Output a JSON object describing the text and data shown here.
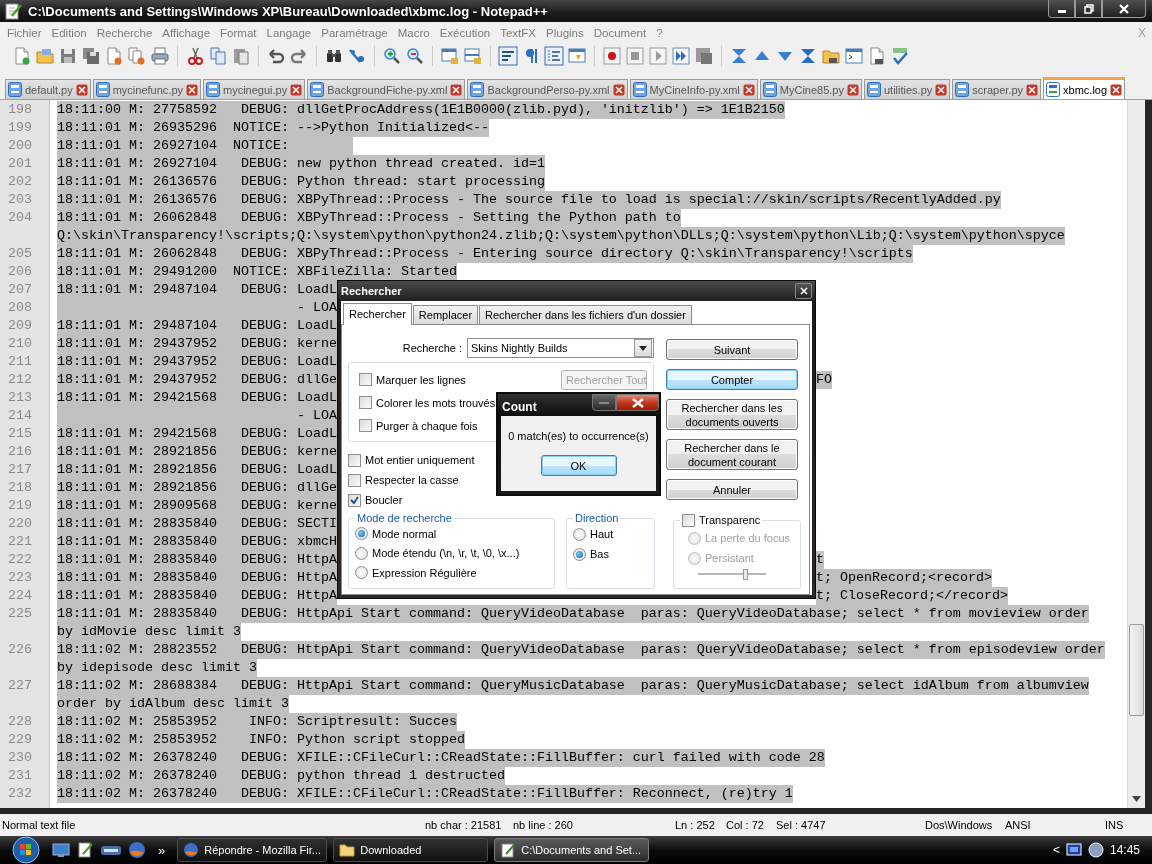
{
  "window": {
    "title": "C:\\Documents and Settings\\Windows XP\\Bureau\\Downloaded\\xbmc.log - Notepad++"
  },
  "menu": [
    "Fichier",
    "Edition",
    "Recherche",
    "Affichage",
    "Format",
    "Langage",
    "Paramétrage",
    "Macro",
    "Exécution",
    "TextFX",
    "Plugins",
    "Document",
    "?"
  ],
  "menu_close": "X",
  "tabs": [
    {
      "label": "default.py",
      "selected": false
    },
    {
      "label": "mycinefunc.py",
      "selected": false
    },
    {
      "label": "mycinegui.py",
      "selected": false
    },
    {
      "label": "BackgroundFiche-py.xml",
      "selected": false
    },
    {
      "label": "BackgroundPerso-py.xml",
      "selected": false
    },
    {
      "label": "MyCineInfo-py.xml",
      "selected": false
    },
    {
      "label": "MyCine85.py",
      "selected": false
    },
    {
      "label": "utilities.py",
      "selected": false
    },
    {
      "label": "scraper.py",
      "selected": false
    },
    {
      "label": "xbmc.log",
      "selected": true
    }
  ],
  "editor": {
    "lines": [
      {
        "number": "198",
        "text": "18:11:00 M: 27758592   DEBUG: dllGetProcAddress(1E1B0000(zlib.pyd), 'initzlib') => 1E1B2150",
        "selected": true
      },
      {
        "number": "199",
        "text": "18:11:01 M: 26935296  NOTICE: -->Python Initialized<--",
        "selected": true
      },
      {
        "number": "200",
        "text": "18:11:01 M: 26927104  NOTICE:        ",
        "selected": true
      },
      {
        "number": "201",
        "text": "18:11:01 M: 26927104   DEBUG: new python thread created. id=1",
        "selected": true
      },
      {
        "number": "202",
        "text": "18:11:01 M: 26136576   DEBUG: Python thread: start processing",
        "selected": true
      },
      {
        "number": "203",
        "text": "18:11:01 M: 26136576   DEBUG: XBPyThread::Process - The source file to load is special://skin/scripts/RecentlyAdded.py",
        "selected": true
      },
      {
        "number": "204",
        "text": "18:11:01 M: 26062848   DEBUG: XBPyThread::Process - Setting the Python path to",
        "wrapped": [
          "Q:\\skin\\Transparency!\\scripts;Q:\\system\\python\\python24.zlib;Q:\\system\\python\\DLLs;Q:\\system\\python\\Lib;Q:\\system\\python\\spyce"
        ],
        "selected": true
      },
      {
        "number": "205",
        "text": "18:11:01 M: 26062848   DEBUG: XBPyThread::Process - Entering source directory Q:\\skin\\Transparency!\\scripts",
        "selected": true
      },
      {
        "number": "206",
        "text": "18:11:01 M: 29491200  NOTICE: XBFileZilla: Started",
        "selected": true
      },
      {
        "number": "207",
        "text": "18:11:01 M: 29487104   DEBUG: LoadL",
        "selected": true
      },
      {
        "number": "208",
        "text": "                              - LOA",
        "selected": true
      },
      {
        "number": "209",
        "text": "18:11:01 M: 29487104   DEBUG: LoadL",
        "selected": true
      },
      {
        "number": "210",
        "text": "18:11:01 M: 29437952   DEBUG: kerne",
        "selected": true
      },
      {
        "number": "211",
        "text": "18:11:01 M: 29437952   DEBUG: LoadL",
        "selected": true
      },
      {
        "number": "212",
        "text": "18:11:01 M: 29437952   DEBUG: dllGe",
        "tail": "FO",
        "selected": true
      },
      {
        "number": "213",
        "text": "18:11:01 M: 29421568   DEBUG: LoadL",
        "selected": true
      },
      {
        "number": "214",
        "text": "                              - LOA",
        "selected": true
      },
      {
        "number": "215",
        "text": "18:11:01 M: 29421568   DEBUG: LoadL",
        "selected": true
      },
      {
        "number": "216",
        "text": "18:11:01 M: 28921856   DEBUG: kerne",
        "selected": true
      },
      {
        "number": "217",
        "text": "18:11:01 M: 28921856   DEBUG: LoadL",
        "selected": true
      },
      {
        "number": "218",
        "text": "18:11:01 M: 28921856   DEBUG: dllGe",
        "selected": true
      },
      {
        "number": "219",
        "text": "18:11:01 M: 28909568   DEBUG: kerne",
        "selected": true
      },
      {
        "number": "220",
        "text": "18:11:01 M: 28835840   DEBUG: SECTI",
        "selected": true
      },
      {
        "number": "221",
        "text": "18:11:01 M: 28835840   DEBUG: xbmcH",
        "selected": true
      },
      {
        "number": "222",
        "text": "18:11:01 M: 28835840   DEBUG: HttpA",
        "tail": "t",
        "selected": true
      },
      {
        "number": "223",
        "text": "18:11:01 M: 28835840   DEBUG: HttpA",
        "tail": "t; OpenRecord;<record>",
        "selected": true
      },
      {
        "number": "224",
        "text": "18:11:01 M: 28835840   DEBUG: HttpA",
        "tail": "t; CloseRecord;</record>",
        "selected": true
      },
      {
        "number": "225",
        "text": "18:11:01 M: 28835840   DEBUG: HttpApi Start command: QueryVideoDatabase  paras: QueryVideoDatabase; select * from movieview order",
        "wrapped": [
          "by idMovie desc limit 3"
        ],
        "selected": true
      },
      {
        "number": "226",
        "text": "18:11:02 M: 28823552   DEBUG: HttpApi Start command: QueryVideoDatabase  paras: QueryVideoDatabase; select * from episodeview order",
        "wrapped": [
          "by idepisode desc limit 3"
        ],
        "selected": true
      },
      {
        "number": "227",
        "text": "18:11:02 M: 28688384   DEBUG: HttpApi Start command: QueryMusicDatabase  paras: QueryMusicDatabase; select idAlbum from albumview",
        "wrapped": [
          "order by idAlbum desc limit 3"
        ],
        "selected": true
      },
      {
        "number": "228",
        "text": "18:11:02 M: 25853952    INFO: Scriptresult: Succes",
        "selected": true
      },
      {
        "number": "229",
        "text": "18:11:02 M: 25853952    INFO: Python script stopped",
        "selected": true
      },
      {
        "number": "230",
        "text": "18:11:02 M: 26378240   DEBUG: XFILE::CFileCurl::CReadState::FillBuffer: curl failed with code 28",
        "selected": true
      },
      {
        "number": "231",
        "text": "18:11:02 M: 26378240   DEBUG: python thread 1 destructed",
        "selected": true
      },
      {
        "number": "232",
        "text": "18:11:02 M: 26378240   DEBUG: XFILE::CFileCurl::CReadState::FillBuffer: Reconnect, (re)try 1",
        "selected": true
      }
    ]
  },
  "find_dialog": {
    "title": "Rechercher",
    "tabs": [
      {
        "label": "Rechercher",
        "selected": true
      },
      {
        "label": "Remplacer",
        "selected": false
      },
      {
        "label": "Rechercher dans les fichiers d'un dossier",
        "selected": false
      }
    ],
    "search_label": "Recherche :",
    "search_value": "Skins Nightly Builds",
    "options": [
      {
        "label": "Marquer les lignes",
        "checked": false
      },
      {
        "label": "Colorer les mots trouvés",
        "checked": false
      },
      {
        "label": "Purger à chaque fois",
        "checked": false
      }
    ],
    "find_all_button": {
      "label": "Rechercher Tout",
      "disabled": true
    },
    "checks": [
      {
        "label": "Mot entier uniquement",
        "checked": false
      },
      {
        "label": "Respecter la casse",
        "checked": false
      },
      {
        "label": "Boucler",
        "checked": true
      }
    ],
    "mode": {
      "title": "Mode de recherche",
      "options": [
        {
          "label": "Mode normal",
          "selected": true
        },
        {
          "label": "Mode étendu (\\n, \\r, \\t, \\0, \\x...)",
          "selected": false
        },
        {
          "label": "Expression Régulière",
          "selected": false
        }
      ]
    },
    "direction": {
      "title": "Direction",
      "options": [
        {
          "label": "Haut",
          "selected": false
        },
        {
          "label": "Bas",
          "selected": true
        }
      ]
    },
    "transparency": {
      "label": "Transparenc",
      "checked": false,
      "options": [
        {
          "label": "La perte du focus",
          "selected": false,
          "disabled": true
        },
        {
          "label": "Persistant",
          "selected": false,
          "disabled": true
        }
      ],
      "level": 0.7
    },
    "buttons": [
      {
        "label": "Suivant",
        "focused": false
      },
      {
        "label": "Compter",
        "focused": true
      },
      {
        "label": "Rechercher dans les documents ouverts",
        "focused": false
      },
      {
        "label": "Rechercher dans le document courant",
        "focused": false
      },
      {
        "label": "Annuler",
        "focused": false
      }
    ]
  },
  "count_dialog": {
    "title": "Count",
    "message": "0 match(es) to occurrence(s)",
    "ok": "OK"
  },
  "status_bar": [
    "Normal text file",
    "nb char : 21581",
    "nb line : 260",
    "Ln : 252",
    "Col : 72",
    "Sel : 4747",
    "Dos\\Windows",
    "ANSI",
    "INS"
  ],
  "taskbar": {
    "more": "»",
    "tasks": [
      {
        "label": "Répondre - Mozilla Fir...",
        "kind": "browser",
        "selected": false
      },
      {
        "label": "Downloaded",
        "kind": "folder",
        "selected": false
      },
      {
        "label": "C:\\Documents and Set...",
        "kind": "editor",
        "selected": true
      }
    ],
    "tray_expand": "<",
    "clock": "14:45"
  }
}
